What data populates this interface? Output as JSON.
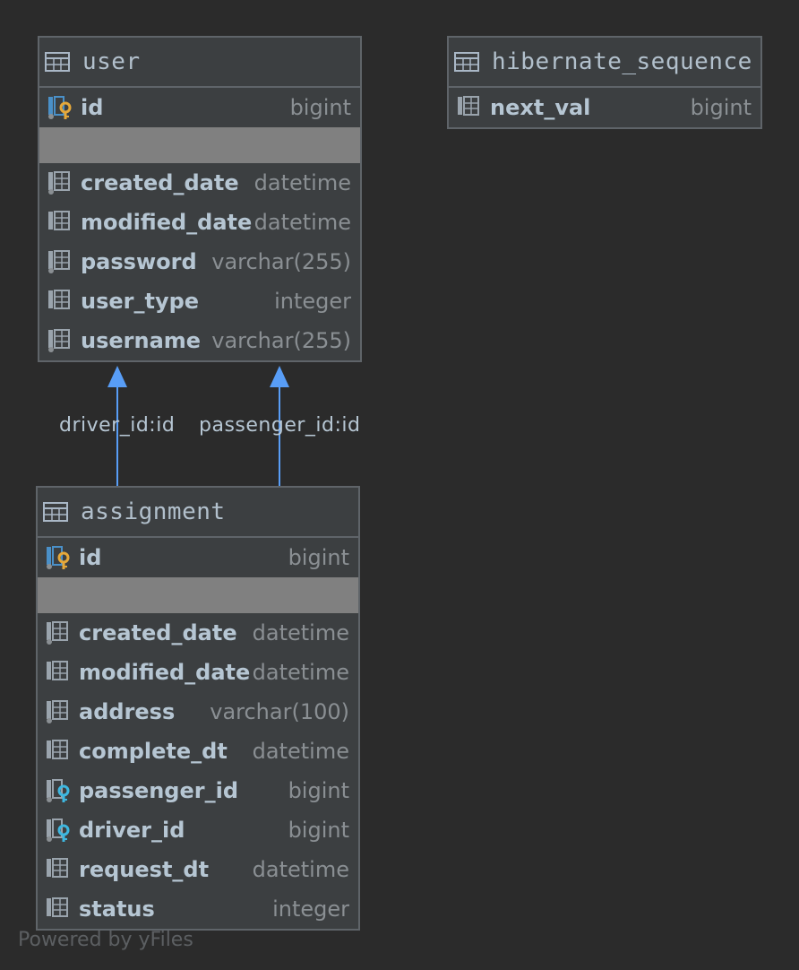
{
  "tables": [
    {
      "id": "user",
      "name": "user",
      "pk": {
        "name": "id",
        "type": "bigint"
      },
      "columns": [
        {
          "name": "created_date",
          "type": "datetime",
          "icon": "column-icon"
        },
        {
          "name": "modified_date",
          "type": "datetime",
          "icon": "column-icon"
        },
        {
          "name": "password",
          "type": "varchar(255)",
          "icon": "column-icon"
        },
        {
          "name": "user_type",
          "type": "integer",
          "icon": "column-icon"
        },
        {
          "name": "username",
          "type": "varchar(255)",
          "icon": "column-icon"
        }
      ]
    },
    {
      "id": "hibernate_sequence",
      "name": "hibernate_sequence",
      "columns": [
        {
          "name": "next_val",
          "type": "bigint",
          "icon": "column-icon"
        }
      ]
    },
    {
      "id": "assignment",
      "name": "assignment",
      "pk": {
        "name": "id",
        "type": "bigint"
      },
      "columns": [
        {
          "name": "created_date",
          "type": "datetime",
          "icon": "column-icon"
        },
        {
          "name": "modified_date",
          "type": "datetime",
          "icon": "column-icon"
        },
        {
          "name": "address",
          "type": "varchar(100)",
          "icon": "column-icon"
        },
        {
          "name": "complete_dt",
          "type": "datetime",
          "icon": "column-icon"
        },
        {
          "name": "passenger_id",
          "type": "bigint",
          "icon": "foreign-key-icon"
        },
        {
          "name": "driver_id",
          "type": "bigint",
          "icon": "foreign-key-icon"
        },
        {
          "name": "request_dt",
          "type": "datetime",
          "icon": "column-icon"
        },
        {
          "name": "status",
          "type": "integer",
          "icon": "column-icon"
        }
      ]
    }
  ],
  "relations": [
    {
      "label": "driver_id:id",
      "from": "assignment",
      "to": "user"
    },
    {
      "label": "passenger_id:id",
      "from": "assignment",
      "to": "user"
    }
  ],
  "colors": {
    "background": "#2b2b2b",
    "table_bg": "#3c3f41",
    "separator": "#808080",
    "link": "#589df6",
    "pk_key": "#e5a83a",
    "fk_key": "#3eb7e0"
  },
  "footer": "Powered by yFiles"
}
